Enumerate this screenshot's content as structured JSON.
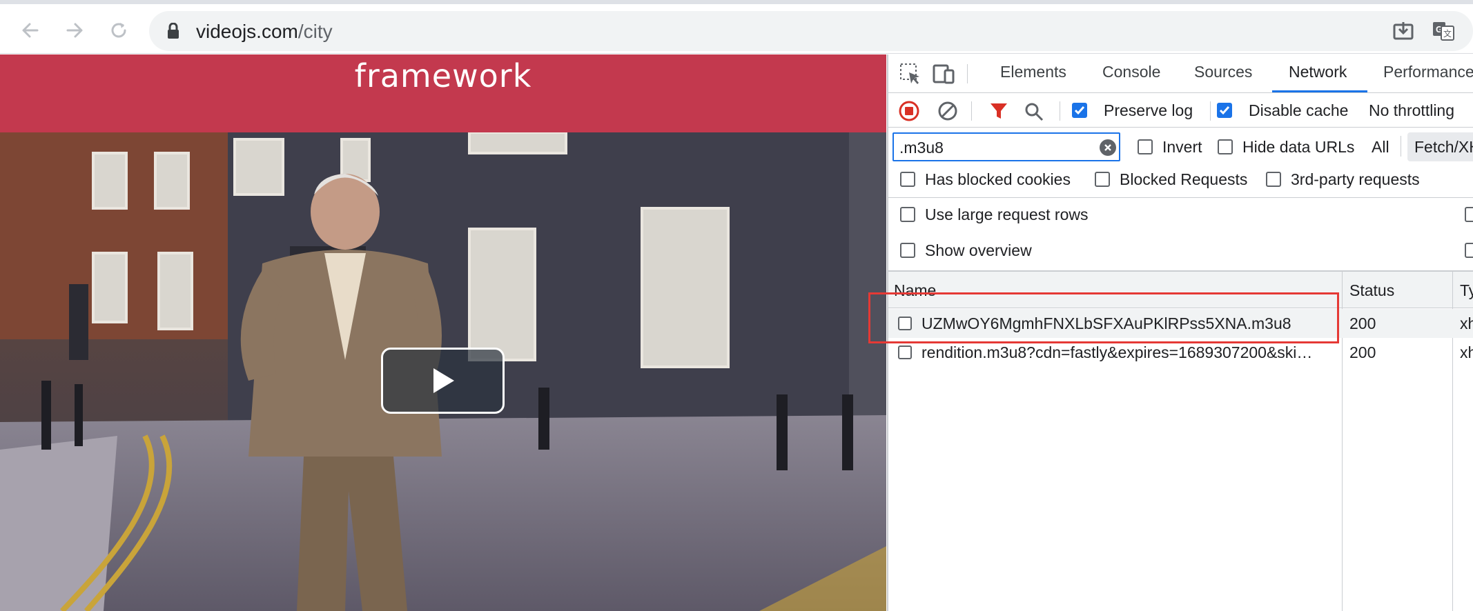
{
  "browser": {
    "url_domain": "videojs.com",
    "url_path": "/city",
    "icons": [
      "back-arrow-icon",
      "forward-arrow-icon",
      "reload-icon",
      "lock-icon",
      "install-app-icon",
      "translate-icon"
    ]
  },
  "page": {
    "banner_title": "framework",
    "banner_color": "#c3394e",
    "play_button_label": "Play"
  },
  "devtools": {
    "tabs": [
      "Elements",
      "Console",
      "Sources",
      "Network",
      "Performance"
    ],
    "active_tab": "Network",
    "toolbar": {
      "preserve_log": "Preserve log",
      "preserve_log_checked": true,
      "disable_cache": "Disable cache",
      "disable_cache_checked": true,
      "throttling": "No throttling"
    },
    "filter": {
      "value": ".m3u8",
      "invert": "Invert",
      "hide_data_urls": "Hide data URLs",
      "all": "All",
      "fetch_xhr": "Fetch/XH"
    },
    "options": {
      "has_blocked_cookies": "Has blocked cookies",
      "blocked_requests": "Blocked Requests",
      "third_party": "3rd-party requests",
      "large_rows": "Use large request rows",
      "show_overview": "Show overview"
    },
    "table": {
      "headers": [
        "Name",
        "Status",
        "Ty"
      ],
      "rows": [
        {
          "name": "UZMwOY6MgmhFNXLbSFXAuPKlRPss5XNA.m3u8",
          "status": "200",
          "type": "xh"
        },
        {
          "name": "rendition.m3u8?cdn=fastly&expires=1689307200&ski…",
          "status": "200",
          "type": "xh"
        }
      ]
    },
    "accent": "#1a73e8",
    "highlight_color": "#e53935"
  }
}
